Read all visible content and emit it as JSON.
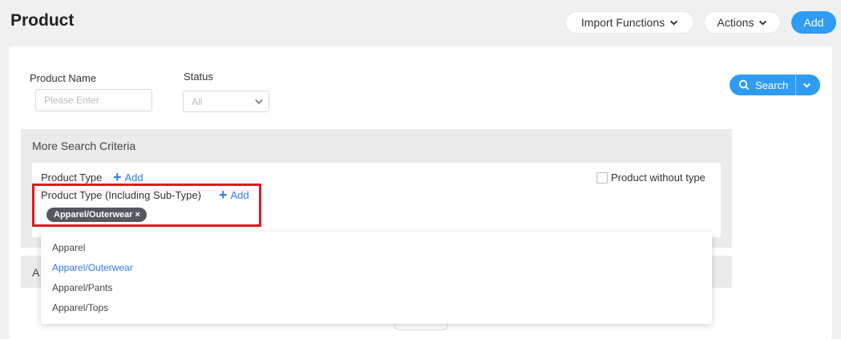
{
  "header": {
    "title": "Product",
    "import_label": "Import Functions",
    "actions_label": "Actions",
    "add_label": "Add"
  },
  "filters": {
    "product_name_label": "Product Name",
    "product_name_placeholder": "Please Enter",
    "status_label": "Status",
    "status_value": "All",
    "search_label": "Search"
  },
  "more_criteria": {
    "title": "More Search Criteria",
    "product_type_label": "Product Type",
    "product_type_add": "Add",
    "product_without_type_label": "Product without type",
    "product_subtype_label": "Product Type (Including Sub-Type)",
    "product_subtype_add": "Add",
    "selected_tag": "Apparel/Outerwear",
    "second_panel_partial_label": "A"
  },
  "dropdown": {
    "items": [
      {
        "label": "Apparel"
      },
      {
        "label": "Apparel/Outerwear"
      },
      {
        "label": "Apparel/Pants"
      },
      {
        "label": "Apparel/Tops"
      }
    ],
    "selected_index": 1
  },
  "colors": {
    "accent": "#2e9cf2",
    "link": "#2e7be6",
    "highlight_border": "#e1191e",
    "tag_bg": "#55585f"
  }
}
